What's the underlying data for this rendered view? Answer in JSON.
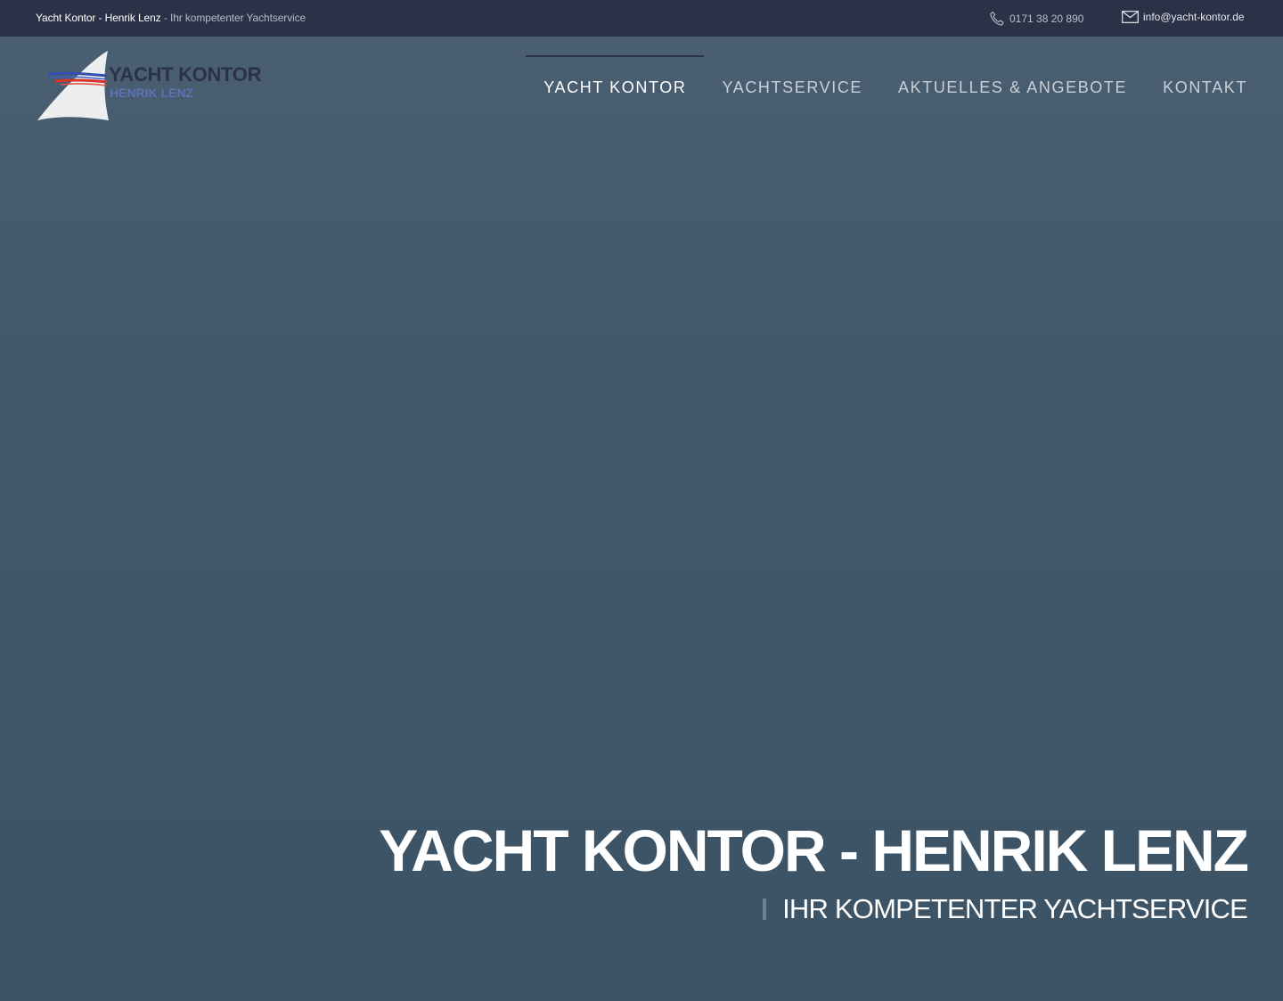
{
  "topbar": {
    "site_name": "Yacht Kontor - Henrik Lenz",
    "separator": " - ",
    "slogan": "Ihr kompetenter Yachtservice",
    "phone": "0171 38 20 890",
    "email": "info@yacht-kontor.de"
  },
  "logo": {
    "line1": "YACHT KONTOR",
    "line2": "HENRIK LENZ"
  },
  "nav": {
    "items": [
      {
        "label": "YACHT KONTOR",
        "active": true
      },
      {
        "label": "YACHTSERVICE",
        "active": false
      },
      {
        "label": "AKTUELLES & ANGEBOTE",
        "active": false
      },
      {
        "label": "KONTAKT",
        "active": false
      }
    ]
  },
  "hero": {
    "title": "YACHT KONTOR - HENRIK LENZ",
    "subtitle": "IHR KOMPETENTER YACHTSERVICE"
  },
  "colors": {
    "topbar_bg": "#2b3247",
    "hero_bg": "#3e5468",
    "logo_dark": "#2c3246",
    "logo_blue": "#5a73b3",
    "active_indicator": "#2c3246"
  },
  "icons": {
    "phone": "phone-icon",
    "email": "mail-icon",
    "logo_mark": "sail-logo-icon"
  }
}
